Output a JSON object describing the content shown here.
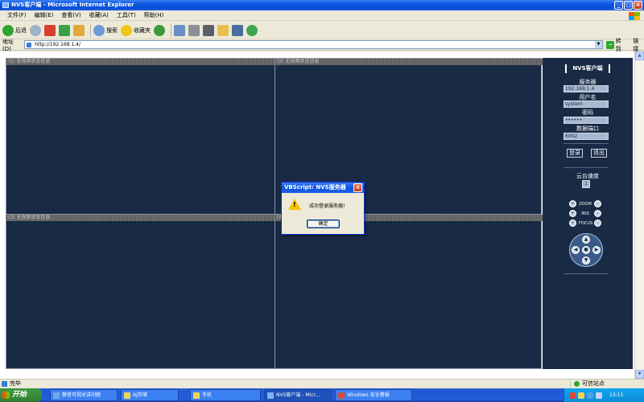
{
  "window": {
    "title": "NVS客户端 - Microsoft Internet Explorer"
  },
  "menu": [
    "文件(F)",
    "编辑(E)",
    "查看(V)",
    "收藏(A)",
    "工具(T)",
    "帮助(H)"
  ],
  "toolbar": {
    "back_label": "后退",
    "search_label": "搜索",
    "favorites_label": "收藏夹"
  },
  "address": {
    "label": "地址(D)",
    "url": "http://192.168.1.4/",
    "go_label": "转到",
    "links_label": "链接"
  },
  "channels": [
    "(1) 无视频状态信息",
    "(2) 无视频状态信息",
    "(3) 无视频状态信息",
    "(4)"
  ],
  "panel": {
    "title": "NVS客户端",
    "server_label": "服务器",
    "server_value": "192.168.1.4",
    "user_label": "用户名",
    "user_value": "system",
    "password_label": "密码",
    "password_value": "••••••",
    "port_label": "数据端口",
    "port_value": "6002",
    "login_label": "登录",
    "logout_label": "退出",
    "speed_label": "云台速度",
    "speed_value": "1",
    "zoom_label": "ZOOM",
    "iris_label": "IRIS",
    "focus_label": "FOCUS"
  },
  "dialog": {
    "title": "VBScript: NVS服务器",
    "message": "成功登录服务器!",
    "ok_label": "确定"
  },
  "status": {
    "left": "完毕",
    "zone": "可信站点"
  },
  "taskbar": {
    "start_label": "开始",
    "tasks": [
      "静音可视对讲问题",
      "AJ存储",
      "手机",
      "NVS客户端 - Micr...",
      "Windows 安全警报"
    ],
    "clock": "13:15"
  },
  "colors": {
    "page_bg": "#192a45",
    "title_blue": "#0b56e0",
    "warning": "#f5c400"
  }
}
